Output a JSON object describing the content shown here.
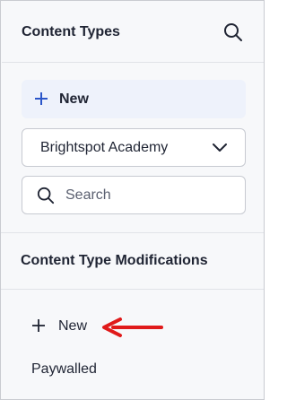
{
  "content_types": {
    "title": "Content Types",
    "new_label": "New",
    "site_select": {
      "selected": "Brightspot Academy"
    },
    "search": {
      "placeholder": "Search"
    }
  },
  "modifications": {
    "title": "Content Type Modifications",
    "new_label": "New",
    "items": [
      "Paywalled"
    ]
  },
  "colors": {
    "accent": "#2b56c9",
    "annotation_arrow": "#e01a1a",
    "panel_background": "#f7f8fa"
  },
  "icons": [
    "search-icon",
    "plus-icon",
    "chevron-down-icon",
    "annotation-arrow-icon"
  ]
}
